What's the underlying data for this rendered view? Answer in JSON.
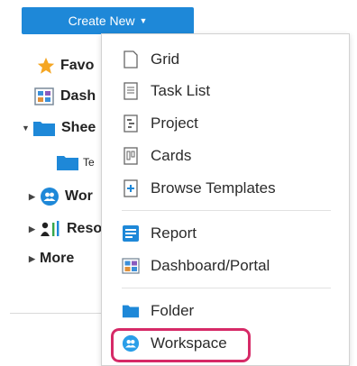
{
  "create_button": {
    "label": "Create New",
    "caret": "▼"
  },
  "sidebar": {
    "favorites": "Favo",
    "dashboards": "Dash",
    "sheets": "Shee",
    "sheet_child": "Te",
    "workspaces": "Wor",
    "resources": "Reso",
    "more": "More"
  },
  "menu": {
    "grid": "Grid",
    "task_list": "Task List",
    "project": "Project",
    "cards": "Cards",
    "browse_templates": "Browse Templates",
    "report": "Report",
    "dashboard_portal": "Dashboard/Portal",
    "folder": "Folder",
    "workspace": "Workspace"
  },
  "colors": {
    "accent_blue": "#1e88d8",
    "highlight": "#d62a67",
    "star": "#f5a623"
  },
  "icons": {
    "grid": "document-icon",
    "task_list": "task-list-icon",
    "project": "project-icon",
    "cards": "cards-icon",
    "browse_templates": "template-icon",
    "report": "report-icon",
    "dashboard_portal": "dashboard-icon",
    "folder": "folder-icon",
    "workspace": "workspace-icon"
  }
}
